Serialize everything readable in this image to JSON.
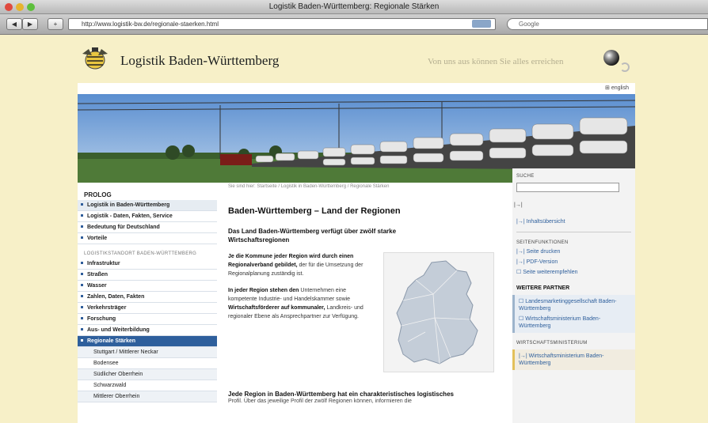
{
  "window": {
    "title": "Logistik Baden-Württemberg: Regionale Stärken"
  },
  "toolbar": {
    "back_label": "◀",
    "forward_label": "▶",
    "add_label": "+",
    "url": "http://www.logistik-bw.de/regionale-staerken.html",
    "search_placeholder": "Google"
  },
  "header": {
    "logo_text": "Logistik Baden-Württemberg",
    "slogan": "Von uns aus können Sie alles erreichen",
    "language_link": "english"
  },
  "sidebar": {
    "heading": "PROLOG",
    "items_top": [
      {
        "label": "Logistik in Baden-Württemberg"
      },
      {
        "label": "Logistik - Daten, Fakten, Service"
      },
      {
        "label": "Bedeutung für Deutschland"
      },
      {
        "label": "Vorteile"
      }
    ],
    "section_label": "LOGISTIKSTANDORT BADEN-WÜRTTEMBERG",
    "items_main": [
      {
        "label": "Infrastruktur"
      },
      {
        "label": "Straßen"
      },
      {
        "label": "Wasser"
      },
      {
        "label": "Zahlen, Daten, Fakten"
      },
      {
        "label": "Verkehrsträger"
      },
      {
        "label": "Forschung"
      },
      {
        "label": "Aus- und Weiterbildung"
      },
      {
        "label": "Regionale Stärken"
      }
    ],
    "subitems": [
      {
        "label": "Stuttgart / Mittlerer Neckar"
      },
      {
        "label": "Bodensee"
      },
      {
        "label": "Südlicher Oberrhein"
      },
      {
        "label": "Schwarzwald"
      },
      {
        "label": "Mittlerer Oberrhein"
      }
    ]
  },
  "main": {
    "breadcrumb": "Sie sind hier: Startseite / Logistik in Baden-Württemberg / Regionale Stärken",
    "title": "Baden-Württemberg – Land der Regionen",
    "lead": "Das Land Baden-Württemberg verfügt über zwölf starke Wirtschaftsregionen",
    "p1_bold": "Je die Kommune jeder Region wird durch einen Regionalverband gebildet,",
    "p1_rest": "der für die Umsetzung der Regionalplanung zuständig ist.",
    "p2_bold": "In jeder Region stehen den",
    "p2_rest": "Unternehmen eine kompetente Industrie- und Handelskammer sowie",
    "p2_bold2": "Wirtschaftsförderer auf kommunaler,",
    "p2_rest2": "Landkreis- und regionaler Ebene als Ansprechpartner zur Verfügung.",
    "footer_bold": "Jede Region in Baden-Württemberg hat ein charakteristisches logistisches",
    "footer_rest": "Profil. Über das jeweilige Profil der zwölf Regionen können, informieren die"
  },
  "right": {
    "search_label": "SUCHE",
    "search_go": "|→|",
    "sitemap_link": "Inhaltsübersicht",
    "functions_label": "SEITENFUNKTIONEN",
    "func_links": [
      {
        "label": "Seite drucken"
      },
      {
        "label": "PDF-Version"
      },
      {
        "label": "Seite weiterempfehlen"
      }
    ],
    "partner_heading": "WEITERE PARTNER",
    "partner_links": [
      {
        "label": "Landesmarketinggesellschaft Baden-Württemberg"
      },
      {
        "label": "Wirtschaftsministerium Baden-Württemberg"
      }
    ],
    "wm_label": "WIRTSCHAFTSMINISTERIUM",
    "wm_link": "Wirtschaftsministerium Baden-Württemberg"
  }
}
